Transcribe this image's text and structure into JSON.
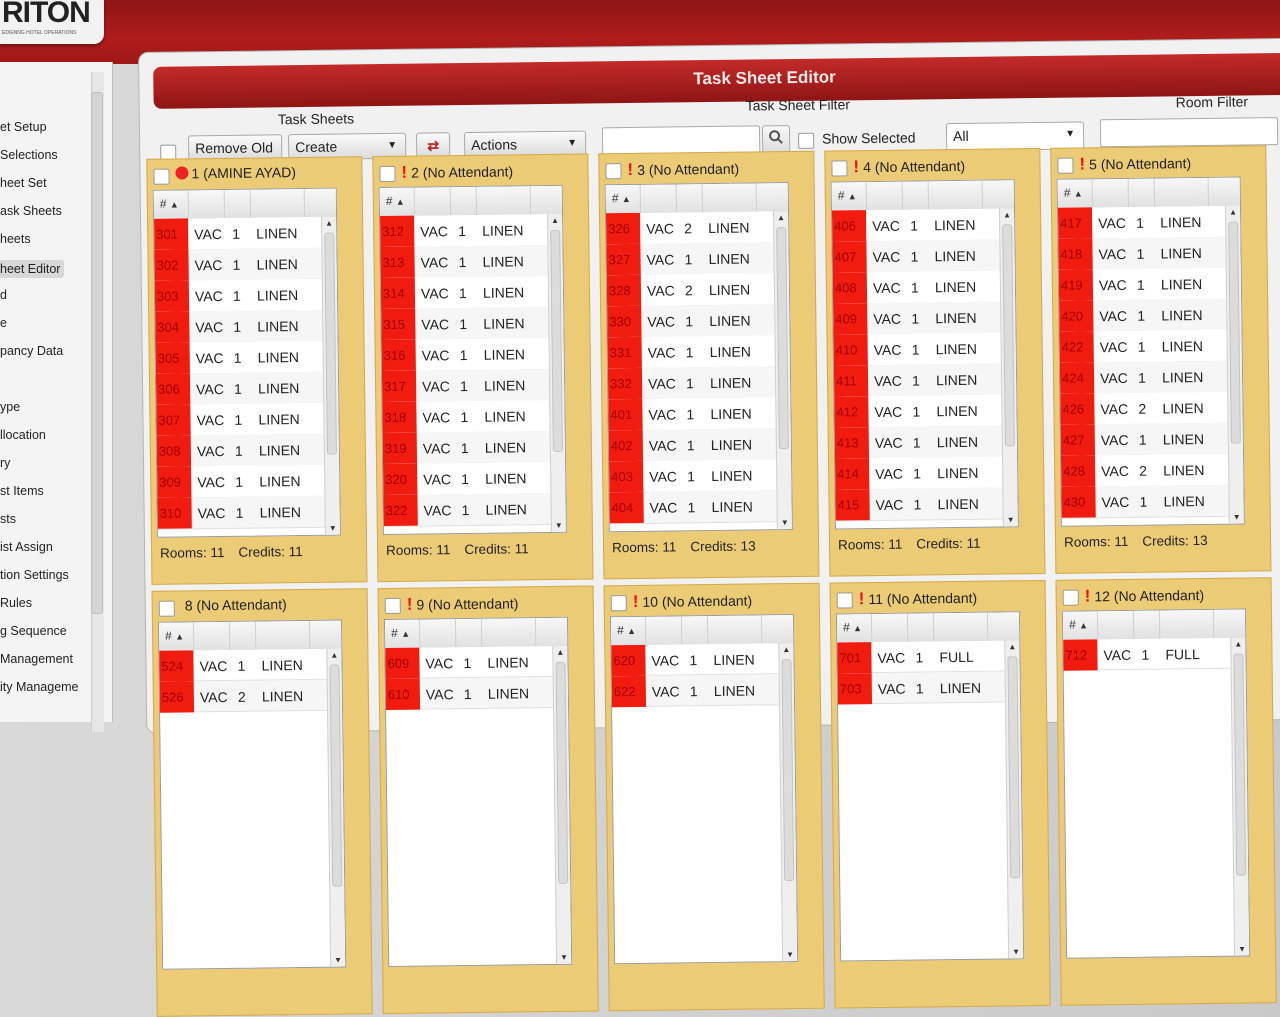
{
  "logo": {
    "brand": "RITON",
    "tagline": "EDIENNG HOTEL OPERATIONS"
  },
  "sidebar": {
    "items": [
      {
        "label": "et Setup"
      },
      {
        "label": "Selections"
      },
      {
        "label": "heet Set"
      },
      {
        "label": "ask Sheets"
      },
      {
        "label": "heets"
      },
      {
        "label": "heet Editor",
        "active": true
      },
      {
        "label": "d"
      },
      {
        "label": "e"
      },
      {
        "label": "pancy Data"
      },
      {
        "label": ""
      },
      {
        "label": "ype"
      },
      {
        "label": "llocation"
      },
      {
        "label": "ry"
      },
      {
        "label": "st Items"
      },
      {
        "label": "sts"
      },
      {
        "label": "ist Assign"
      },
      {
        "label": "tion Settings"
      },
      {
        "label": "Rules"
      },
      {
        "label": "g Sequence"
      },
      {
        "label": "Management"
      },
      {
        "label": "ity Manageme"
      }
    ]
  },
  "window": {
    "title": "Task Sheet Editor"
  },
  "toolbar": {
    "task_sheets_label": "Task Sheets",
    "remove_old": "Remove Old",
    "create": "Create",
    "refresh_glyph": "⇄",
    "actions": "Actions",
    "filter_label": "Task Sheet Filter",
    "search_value": "",
    "show_selected": "Show Selected",
    "filter_select": "All",
    "room_filter_label": "Room Filter",
    "room_filter_value": ""
  },
  "grid_header": {
    "col1": "#",
    "sort": "▲"
  },
  "sheets": [
    {
      "title": "1 (AMINE AYAD)",
      "indicator": "dot",
      "rooms": "Rooms: 11",
      "credits": "Credits: 11",
      "rows": [
        [
          "301",
          "VAC",
          "1",
          "LINEN"
        ],
        [
          "302",
          "VAC",
          "1",
          "LINEN"
        ],
        [
          "303",
          "VAC",
          "1",
          "LINEN"
        ],
        [
          "304",
          "VAC",
          "1",
          "LINEN"
        ],
        [
          "305",
          "VAC",
          "1",
          "LINEN"
        ],
        [
          "306",
          "VAC",
          "1",
          "LINEN"
        ],
        [
          "307",
          "VAC",
          "1",
          "LINEN"
        ],
        [
          "308",
          "VAC",
          "1",
          "LINEN"
        ],
        [
          "309",
          "VAC",
          "1",
          "LINEN"
        ],
        [
          "310",
          "VAC",
          "1",
          "LINEN"
        ]
      ]
    },
    {
      "title": "2 (No Attendant)",
      "indicator": "excl",
      "rooms": "Rooms: 11",
      "credits": "Credits: 11",
      "rows": [
        [
          "312",
          "VAC",
          "1",
          "LINEN"
        ],
        [
          "313",
          "VAC",
          "1",
          "LINEN"
        ],
        [
          "314",
          "VAC",
          "1",
          "LINEN"
        ],
        [
          "315",
          "VAC",
          "1",
          "LINEN"
        ],
        [
          "316",
          "VAC",
          "1",
          "LINEN"
        ],
        [
          "317",
          "VAC",
          "1",
          "LINEN"
        ],
        [
          "318",
          "VAC",
          "1",
          "LINEN"
        ],
        [
          "319",
          "VAC",
          "1",
          "LINEN"
        ],
        [
          "320",
          "VAC",
          "1",
          "LINEN"
        ],
        [
          "322",
          "VAC",
          "1",
          "LINEN"
        ]
      ]
    },
    {
      "title": "3 (No Attendant)",
      "indicator": "excl",
      "rooms": "Rooms: 11",
      "credits": "Credits: 13",
      "rows": [
        [
          "326",
          "VAC",
          "2",
          "LINEN"
        ],
        [
          "327",
          "VAC",
          "1",
          "LINEN"
        ],
        [
          "328",
          "VAC",
          "2",
          "LINEN"
        ],
        [
          "330",
          "VAC",
          "1",
          "LINEN"
        ],
        [
          "331",
          "VAC",
          "1",
          "LINEN"
        ],
        [
          "332",
          "VAC",
          "1",
          "LINEN"
        ],
        [
          "401",
          "VAC",
          "1",
          "LINEN"
        ],
        [
          "402",
          "VAC",
          "1",
          "LINEN"
        ],
        [
          "403",
          "VAC",
          "1",
          "LINEN"
        ],
        [
          "404",
          "VAC",
          "1",
          "LINEN"
        ]
      ]
    },
    {
      "title": "4 (No Attendant)",
      "indicator": "excl",
      "rooms": "Rooms: 11",
      "credits": "Credits: 11",
      "rows": [
        [
          "406",
          "VAC",
          "1",
          "LINEN"
        ],
        [
          "407",
          "VAC",
          "1",
          "LINEN"
        ],
        [
          "408",
          "VAC",
          "1",
          "LINEN"
        ],
        [
          "409",
          "VAC",
          "1",
          "LINEN"
        ],
        [
          "410",
          "VAC",
          "1",
          "LINEN"
        ],
        [
          "411",
          "VAC",
          "1",
          "LINEN"
        ],
        [
          "412",
          "VAC",
          "1",
          "LINEN"
        ],
        [
          "413",
          "VAC",
          "1",
          "LINEN"
        ],
        [
          "414",
          "VAC",
          "1",
          "LINEN"
        ],
        [
          "415",
          "VAC",
          "1",
          "LINEN"
        ]
      ]
    },
    {
      "title": "5 (No Attendant)",
      "indicator": "excl",
      "rooms": "Rooms: 11",
      "credits": "Credits: 13",
      "rows": [
        [
          "417",
          "VAC",
          "1",
          "LINEN"
        ],
        [
          "418",
          "VAC",
          "1",
          "LINEN"
        ],
        [
          "419",
          "VAC",
          "1",
          "LINEN"
        ],
        [
          "420",
          "VAC",
          "1",
          "LINEN"
        ],
        [
          "422",
          "VAC",
          "1",
          "LINEN"
        ],
        [
          "424",
          "VAC",
          "1",
          "LINEN"
        ],
        [
          "426",
          "VAC",
          "2",
          "LINEN"
        ],
        [
          "427",
          "VAC",
          "1",
          "LINEN"
        ],
        [
          "428",
          "VAC",
          "2",
          "LINEN"
        ],
        [
          "430",
          "VAC",
          "1",
          "LINEN"
        ]
      ]
    },
    {
      "title": "8 (No Attendant)",
      "indicator": "none",
      "rooms": "",
      "credits": "",
      "rows": [
        [
          "524",
          "VAC",
          "1",
          "LINEN"
        ],
        [
          "526",
          "VAC",
          "2",
          "LINEN"
        ]
      ]
    },
    {
      "title": "9 (No Attendant)",
      "indicator": "excl",
      "rooms": "",
      "credits": "",
      "rows": [
        [
          "609",
          "VAC",
          "1",
          "LINEN"
        ],
        [
          "610",
          "VAC",
          "1",
          "LINEN"
        ]
      ]
    },
    {
      "title": "10 (No Attendant)",
      "indicator": "excl",
      "rooms": "",
      "credits": "",
      "rows": [
        [
          "620",
          "VAC",
          "1",
          "LINEN"
        ],
        [
          "622",
          "VAC",
          "1",
          "LINEN"
        ]
      ]
    },
    {
      "title": "11 (No Attendant)",
      "indicator": "excl",
      "rooms": "",
      "credits": "",
      "rows": [
        [
          "701",
          "VAC",
          "1",
          "FULL"
        ],
        [
          "703",
          "VAC",
          "1",
          "LINEN"
        ]
      ]
    },
    {
      "title": "12 (No Attendant)",
      "indicator": "excl",
      "rooms": "",
      "credits": "",
      "rows": [
        [
          "712",
          "VAC",
          "1",
          "FULL"
        ]
      ]
    }
  ]
}
